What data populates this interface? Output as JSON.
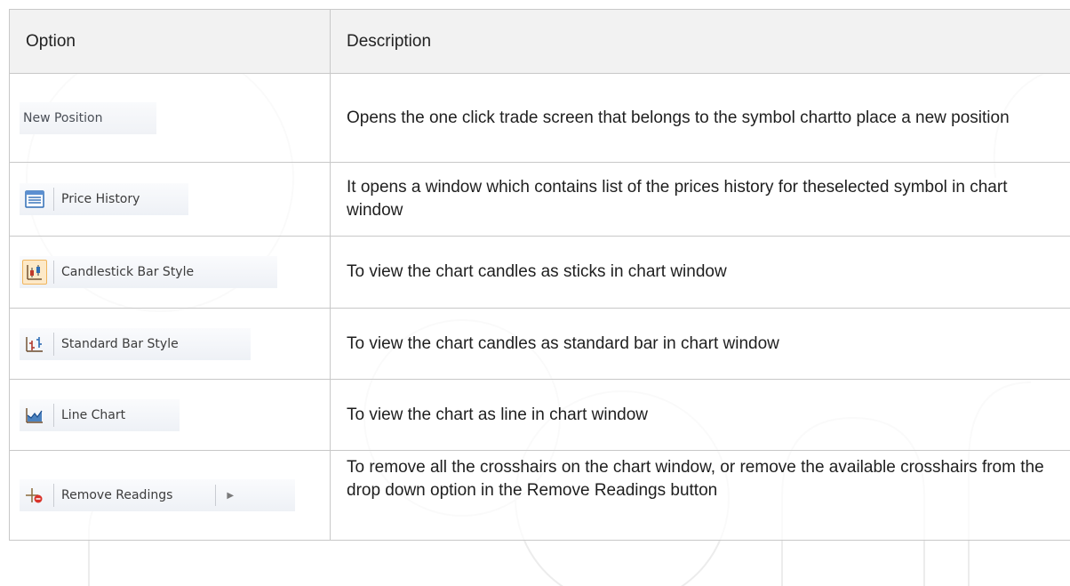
{
  "table": {
    "header": {
      "option": "Option",
      "description": "Description"
    },
    "rows": [
      {
        "option_label": "New Position",
        "icon": "none",
        "description": "Opens the one click trade screen that belongs to the symbol chartto place a new position"
      },
      {
        "option_label": "Price History",
        "icon": "price-history-icon",
        "description": "It opens a window which contains list of the prices history for theselected symbol in chart window"
      },
      {
        "option_label": "Candlestick Bar Style",
        "icon": "candlestick-icon",
        "description": "To view the chart candles as sticks in chart window"
      },
      {
        "option_label": "Standard Bar Style",
        "icon": "standard-bar-icon",
        "description": "To view the chart candles as standard bar in chart window"
      },
      {
        "option_label": "Line Chart",
        "icon": "line-chart-icon",
        "description": "To view the chart as line in chart window"
      },
      {
        "option_label": "Remove Readings",
        "icon": "remove-readings-icon",
        "description": "To remove all the crosshairs on the chart window, or remove the available crosshairs from the drop down option in the Remove Readings button"
      }
    ]
  },
  "colors": {
    "header_bg": "#f2f2f2",
    "border": "#c8c8c8",
    "candlestick_highlight": "#fde9c8",
    "icon_blue": "#2e6db5",
    "remove_red": "#d9342b"
  }
}
